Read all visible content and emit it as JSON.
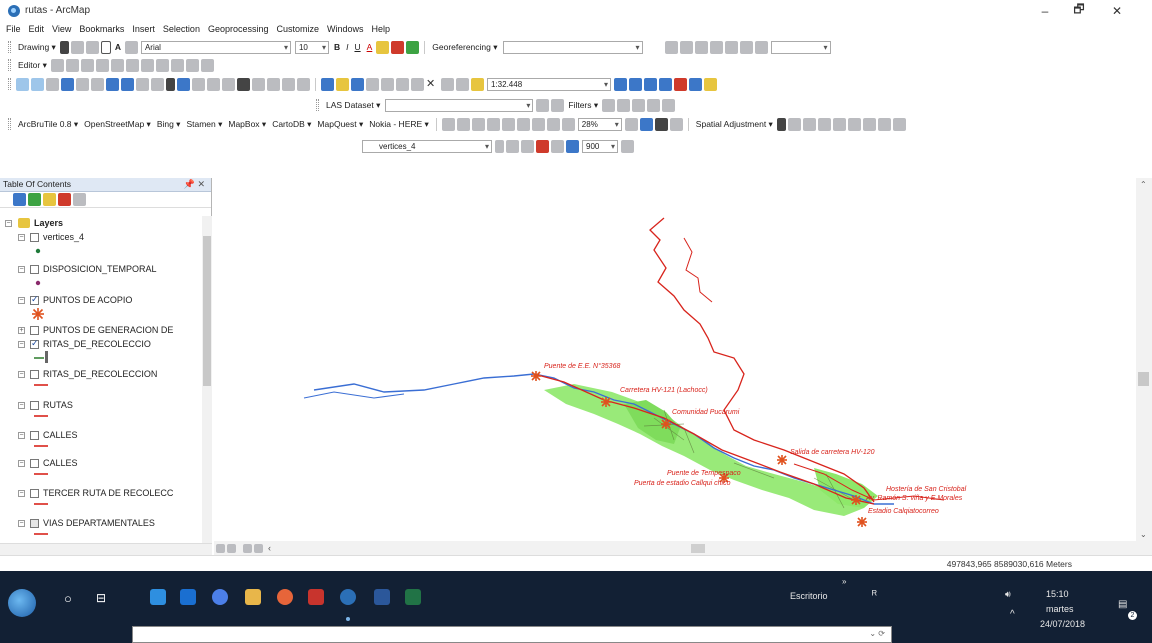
{
  "window": {
    "title": "rutas - ArcMap",
    "minimize": "–",
    "maximize": "🗗",
    "close": "✕"
  },
  "menu": [
    "File",
    "Edit",
    "View",
    "Bookmarks",
    "Insert",
    "Selection",
    "Geoprocessing",
    "Customize",
    "Windows",
    "Help"
  ],
  "toolbars": {
    "drawing_label": "Drawing ▾",
    "font_name": "Arial",
    "font_size": "10",
    "bold": "B",
    "italic": "I",
    "underline": "U",
    "font_color": "A",
    "georef_label": "Georeferencing ▾",
    "editor_label": "Editor ▾",
    "scale_value": "1:32.448",
    "las_label": "LAS Dataset ▾",
    "filters_label": "Filters ▾",
    "arcbrutile": "ArcBruTile 0.8 ▾",
    "tile_sources": [
      "OpenStreetMap ▾",
      "Bing ▾",
      "Stamen ▾",
      "MapBox ▾",
      "CartoDB ▾",
      "MapQuest ▾",
      "Nokia - HERE ▾"
    ],
    "transparency": "28%",
    "spatial_adjustment": "Spatial Adjustment ▾",
    "layer_combo": "vertices_4",
    "tolerance": "900"
  },
  "toc": {
    "title": "Table Of Contents",
    "pin": "📌 ✕",
    "root": "Layers",
    "layers": [
      {
        "name": "vertices_4",
        "checked": false
      },
      {
        "name": "DISPOSICION_TEMPORAL",
        "checked": false
      },
      {
        "name": "PUNTOS DE ACOPIO",
        "checked": true
      },
      {
        "name": "PUNTOS DE GENERACION DE",
        "checked": false
      },
      {
        "name": "RITAS_DE_RECOLECCIO",
        "checked": true
      },
      {
        "name": "RITAS_DE_RECOLECCION",
        "checked": false
      },
      {
        "name": "RUTAS",
        "checked": false
      },
      {
        "name": "CALLES",
        "checked": false
      },
      {
        "name": "CALLES",
        "checked": false
      },
      {
        "name": "TERCER RUTA DE RECOLECC",
        "checked": false
      },
      {
        "name": "VIAS DEPARTAMENTALES",
        "checked": false
      }
    ]
  },
  "map": {
    "labels": [
      "Puente de E.E. N°35368",
      "Carretera HV-121 (Lachocc)",
      "Comunidad Pucarumi",
      "Salida de carretera HV-120",
      "Puente de Tempespaco",
      "Puerta de estadio Callqui chico",
      "Hostería de San Cristobal",
      "Av. Ramón S. viña y E.Morales",
      "Estadio Calqiatocorreo"
    ]
  },
  "status": {
    "coords": "497843,965  8589030,616 Meters"
  },
  "taskbar": {
    "desk_label": "Escritorio",
    "time": "15:10",
    "day": "martes",
    "date": "24/07/2018",
    "notif_count": "2"
  },
  "colors": {
    "river": "#3a6ed4",
    "road": "#d8241c",
    "urban": "#8ee86a",
    "marker": "#e0521f"
  }
}
